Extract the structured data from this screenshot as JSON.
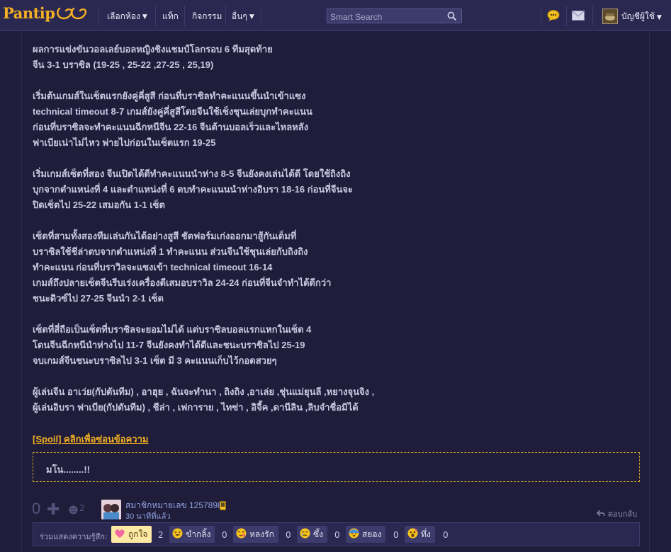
{
  "brand": {
    "name": "Pantip"
  },
  "nav": {
    "rooms": "เลือกห้อง",
    "tags": "แท็ก",
    "activities": "กิจกรรม",
    "more": "อื่นๆ"
  },
  "search": {
    "placeholder": "Smart Search"
  },
  "account": {
    "label": "บัญชีผู้ใช้"
  },
  "story": {
    "paragraphs": [
      [
        "ผลการแข่งขันวอลเลย์บอลหญิงชิงแชมป์โลกรอบ 6 ทีมสุดท้าย",
        "จีน 3-1 บราซิล (19-25 , 25-22 ,27-25 , 25,19)"
      ],
      [
        "เริ่มต้นเกมส์ในเซ็ตแรกยังคู่คี่สูสี ก่อนที่บราซิลทำคะแนนขึ้นนำเข้าแซง",
        "technical timeout 8-7 เกมส์ยังคู่คี่สูสีโดยจีนใช้เซ็งชุนเล่ยบุกทำคะแนน",
        "ก่อนที่บราซิลจะทำคะแนนฉีกหนีจีน 22-16 จีนต้านบอลเร็วและไหลหลัง",
        "ฟาเบียเน่าไม่ไหว พ่ายไปก่อนในเซ็ตแรก 19-25"
      ],
      [
        "เริ่มเกมส์เซ็ตที่สอง จีนเปิดได้ดีทำคะแนนนำห่าง 8-5 จีนยังคงเล่นได้ดี โดยใช้ถิงถิง",
        "บุกจากตำแหน่งที่ 4 และตำแหน่งที่ 6 ตบทำคะแนนนำห่างอิบรา 18-16 ก่อนที่จีนจะ",
        "ปิดเซ็ตไป 25-22 เสมอกัน 1-1 เซ็ต"
      ],
      [
        "เซ็ตที่สามทั้งสองทีมเล่นกันได้อย่างสูสี ชัตฟอร์มเก่งออกมาสู้กันเต็มที่",
        "บราซิลใช้ชีล่าตบจากตำแหน่งที่ 1 ทำคะแนน ส่วนจีนใช้ชุนเล่ยกับถิงถิง",
        "ทำคะแนน ก่อนที่บราวิลจะแซงเข้า technical timeout 16-14",
        "เกมส์ถึงปลายเซ็ตจีนรีบเร่งเครื่องดีเสมอบราวิล 24-24 ก่อนที่จีนจำทำได้ดีกว่า",
        "ชนะดิวซ์ไป 27-25 จีนนำ 2-1 เซ็ต"
      ],
      [
        "เซ็ตที่สี่ถือเป็นเซ็ตที่บราซิลจะยอมไม่ได้ แต่บราซิลบอลแรกแหกในเซ็ต 4",
        "โดนจีนฉีกหนีนำห่างไป 11-7 จีนยังคงทำได้ดีและชนะบราซิลไป 25-19",
        "จบเกมส์จีนชนะบราซิลไป 3-1 เซ็ต มี 3 คะแนนเก็บไว้กอดสวยๆ"
      ],
      [
        "ผู้เล่นจีน อาเว่ย(กัปตันทีม) , อาฮุย , ฉันจะทำนา , ถิงถิง ,อาเล่ย ,ชุ่นแม่ยุนลี ,หยางจุนจิง ,",
        "ผู้เล่นอิบรา ฟาเบีย(กัปตันทีม) , ชีล่า , เฟการาย , ไทซ่า , อิจี้ค ,ดานีลิน ,ลิบจำชื่อมิได้"
      ]
    ]
  },
  "spoiler": {
    "link": "[Spoil] คลิกเพื่อซ่อนข้อความ",
    "content": "มโน........!!"
  },
  "footer": {
    "vote_count": "0",
    "emotion_count": "2",
    "poster": "สมาชิกหมายเลข 1257898",
    "time": "30 นาทีที่แล้ว",
    "reply": "ตอบกลับ"
  },
  "emotions": {
    "label": "ร่วมแสดงความรู้สึก:",
    "items": [
      {
        "name": "ถูกใจ",
        "count": "2",
        "icon": "heart-face"
      },
      {
        "name": "ขำกลิ้ง",
        "count": "0",
        "icon": "laugh-face"
      },
      {
        "name": "หลงรัก",
        "count": "0",
        "icon": "love-face"
      },
      {
        "name": "ซึ้ง",
        "count": "0",
        "icon": "touched-face"
      },
      {
        "name": "สยอง",
        "count": "0",
        "icon": "scared-face"
      },
      {
        "name": "ทึ่ง",
        "count": "0",
        "icon": "wow-face"
      }
    ]
  },
  "colors": {
    "background": "#1f1d3a",
    "navbar": "#2a2850",
    "brand": "#f4b024",
    "spoiler_border": "#c8a228",
    "text": "#c9c7e0",
    "link_blue": "#8fa0de"
  }
}
